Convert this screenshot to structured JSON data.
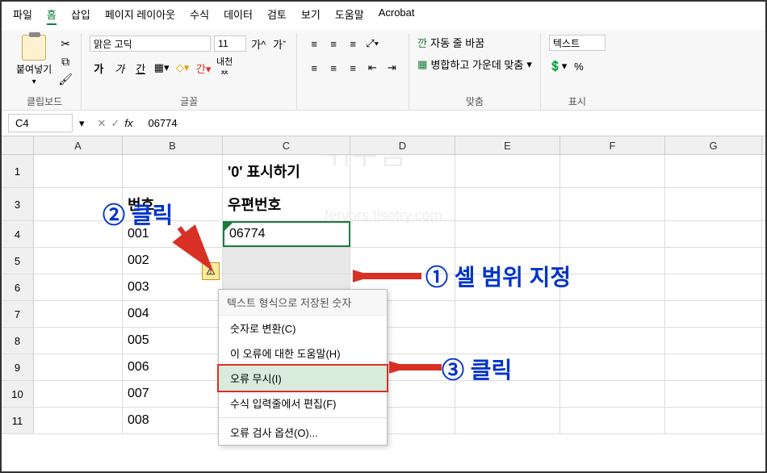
{
  "menu": {
    "items": [
      "파일",
      "홈",
      "삽입",
      "페이지 레이아웃",
      "수식",
      "데이터",
      "검토",
      "보기",
      "도움말",
      "Acrobat"
    ],
    "active_index": 1
  },
  "ribbon": {
    "clipboard_label": "클립보드",
    "paste_label": "붙여넣기",
    "font_group_label": "글꼴",
    "font_name": "맑은 고딕",
    "font_size": "11",
    "align_group_label": "맞춤",
    "wrap_label": "자동 줄 바꿈",
    "merge_label": "병합하고 가운데 맞춤",
    "number_group_label": "표시",
    "number_format": "텍스트"
  },
  "formula_bar": {
    "name_box": "C4",
    "fx_label": "fx",
    "formula_value": "06774"
  },
  "columns": [
    "A",
    "B",
    "C",
    "D",
    "E",
    "F",
    "G"
  ],
  "rows": [
    {
      "num": "1",
      "b": "",
      "c": "'0' 표시하기"
    },
    {
      "num": "3",
      "b": "번호",
      "c": "우편번호"
    },
    {
      "num": "4",
      "b": "001",
      "c": "06774"
    },
    {
      "num": "5",
      "b": "002",
      "c": ""
    },
    {
      "num": "6",
      "b": "003",
      "c": ""
    },
    {
      "num": "7",
      "b": "004",
      "c": ""
    },
    {
      "num": "8",
      "b": "005",
      "c": ""
    },
    {
      "num": "9",
      "b": "006",
      "c": ""
    },
    {
      "num": "10",
      "b": "007",
      "c": ""
    },
    {
      "num": "11",
      "b": "008",
      "c": ""
    }
  ],
  "context_menu": {
    "header": "텍스트 형식으로 저장된 숫자",
    "items": [
      "숫자로 변환(C)",
      "이 오류에 대한 도움말(H)",
      "오류 무시(I)",
      "수식 입력줄에서 편집(F)",
      "오류 검사 옵션(O)..."
    ],
    "highlighted_index": 2
  },
  "annotations": {
    "step1": "① 셀 범위 지정",
    "step2": "② 클릭",
    "step3": "③ 클릭"
  },
  "watermark": {
    "main": "쉬우쌤",
    "sub": "fervors.tisotry.com"
  }
}
